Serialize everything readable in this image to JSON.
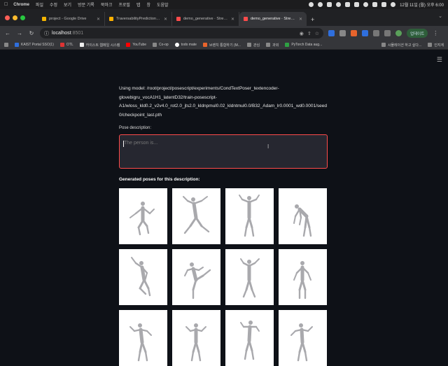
{
  "menubar": {
    "app_name": "Chrome",
    "menus": [
      "파일",
      "수정",
      "보기",
      "방문 기록",
      "북마크",
      "프로필",
      "탭",
      "창",
      "도움말"
    ],
    "clock": "12월 11일 (월) 오후 6:00"
  },
  "tabs": [
    {
      "label": "project - Google Drive",
      "favicon_color": "#f4b400",
      "active": false
    },
    {
      "label": "TraversabilityPredictionNetwo",
      "favicon_color": "#ffb000",
      "active": false
    },
    {
      "label": "demo_generative · Streamlit",
      "favicon_color": "#ff4b4b",
      "active": false
    },
    {
      "label": "demo_generative · Streamlit",
      "favicon_color": "#ff4b4b",
      "active": true
    }
  ],
  "toolbar": {
    "url_host": "localhost",
    "url_port": ":8501",
    "profile_label": "업데이트"
  },
  "bookmarks": [
    {
      "label": "KAIST Portal SSO(1)"
    },
    {
      "label": "OTL"
    },
    {
      "label": "카이스트 웹메일 시스템"
    },
    {
      "label": "YouTube"
    },
    {
      "label": "Co-op"
    },
    {
      "label": "todo mate"
    },
    {
      "label": "브랜치 통합하기 (M..."
    },
    {
      "label": "관심"
    },
    {
      "label": "과외"
    },
    {
      "label": "PyTorch Data aug..."
    },
    {
      "label": "시뮬레이션 하고 싶다..."
    },
    {
      "label": "인지계"
    }
  ],
  "app": {
    "model_text": "Using model: /root/project/posescript/experiments/CondTextPoser_textencoder-glovebigru_vocA1H1_latentD32/train-posescript-A1/wloss_kld0.2_v2v4.0_rot2.0_jts2.0_kldnpmul0.02_kldntmul0.0/B32_Adam_lr0.0001_wd0.0001/seed0/checkpoint_last.pth",
    "pose_label": "Pose description:",
    "pose_placeholder": "The person is...",
    "generated_label": "Generated poses for this description:"
  },
  "poses": [
    {
      "kind": "crouch-arms-out"
    },
    {
      "kind": "lunge-arms-up"
    },
    {
      "kind": "stand-arms-up"
    },
    {
      "kind": "bend-forward"
    },
    {
      "kind": "kneel-reach"
    },
    {
      "kind": "high-kick"
    },
    {
      "kind": "walk-arms-up"
    },
    {
      "kind": "stand-arms-out"
    },
    {
      "kind": "partial-1"
    },
    {
      "kind": "partial-2"
    },
    {
      "kind": "partial-3"
    },
    {
      "kind": "partial-4"
    }
  ]
}
